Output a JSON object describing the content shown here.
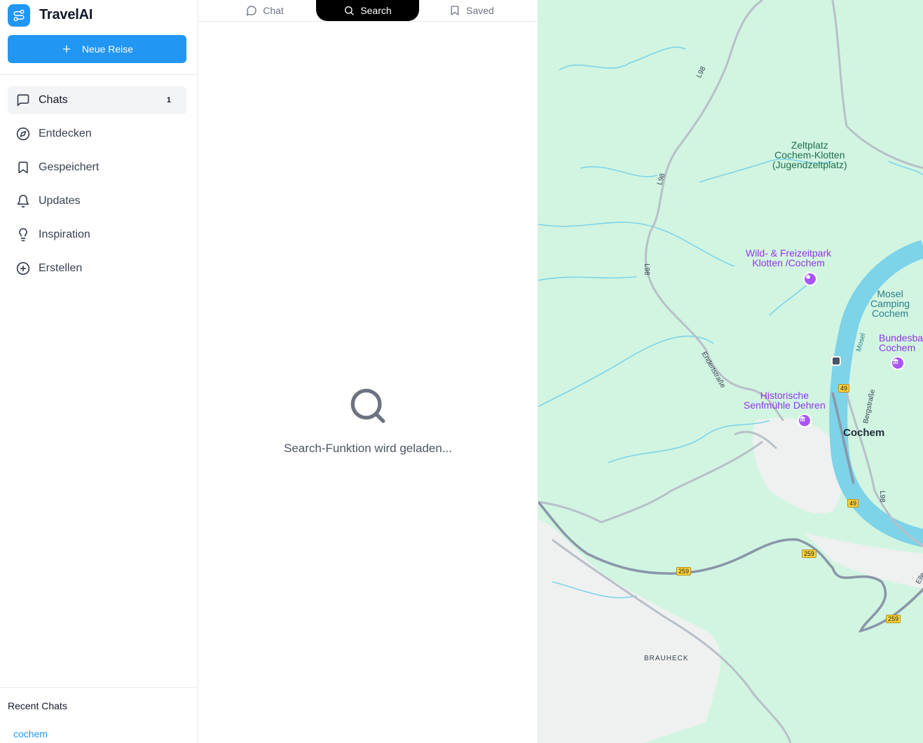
{
  "app": {
    "name": "TravelAI",
    "new_trip_label": "Neue Reise"
  },
  "sidebar": {
    "items": [
      {
        "label": "Chats",
        "icon": "chat-bubble-icon",
        "badge": "1",
        "active": true
      },
      {
        "label": "Entdecken",
        "icon": "compass-icon"
      },
      {
        "label": "Gespeichert",
        "icon": "bookmark-icon"
      },
      {
        "label": "Updates",
        "icon": "bell-icon"
      },
      {
        "label": "Inspiration",
        "icon": "lightbulb-icon"
      },
      {
        "label": "Erstellen",
        "icon": "plus-circle-icon"
      }
    ],
    "recent_title": "Recent Chats",
    "recent_items": [
      "cochem"
    ]
  },
  "tabs": [
    {
      "label": "Chat",
      "icon": "chat-bubble-icon"
    },
    {
      "label": "Search",
      "icon": "search-icon",
      "active": true
    },
    {
      "label": "Saved",
      "icon": "bookmark-icon"
    }
  ],
  "search": {
    "loading_text": "Search-Funktion wird geladen..."
  },
  "map": {
    "labels": {
      "zeltplatz": "Zeltplatz\nCochem-Klotten\n(Jugendzeltplatz)",
      "wildpark": "Wild- & Freizeitpark\nKlotten /Cochem",
      "camping": "Mosel\nCamping\nCochem",
      "bundesbank": "Bundesban\nCochem",
      "senfmuehle": "Historische\nSenfmühle Dehren",
      "cochem": "Cochem",
      "brauheck": "BRAUHECK",
      "mosel": "Mosel",
      "endertstrasse": "Endertstraße",
      "bergstrasse": "Bergstraße",
      "elle": "Elle"
    },
    "road_shields": {
      "b49_a": "49",
      "b49_b": "49",
      "b259_a": "259",
      "b259_b": "259",
      "b259_c": "259"
    },
    "road_labels": {
      "l98_a": "L98",
      "l98_b": "L98",
      "l98_c": "L98",
      "l98_d": "L98"
    },
    "colors": {
      "land": "#d1f5e1",
      "water": "#7dd3e8",
      "road": "#b8c0c8",
      "highway": "#8a96a8",
      "urban": "#f1f3f4"
    }
  }
}
